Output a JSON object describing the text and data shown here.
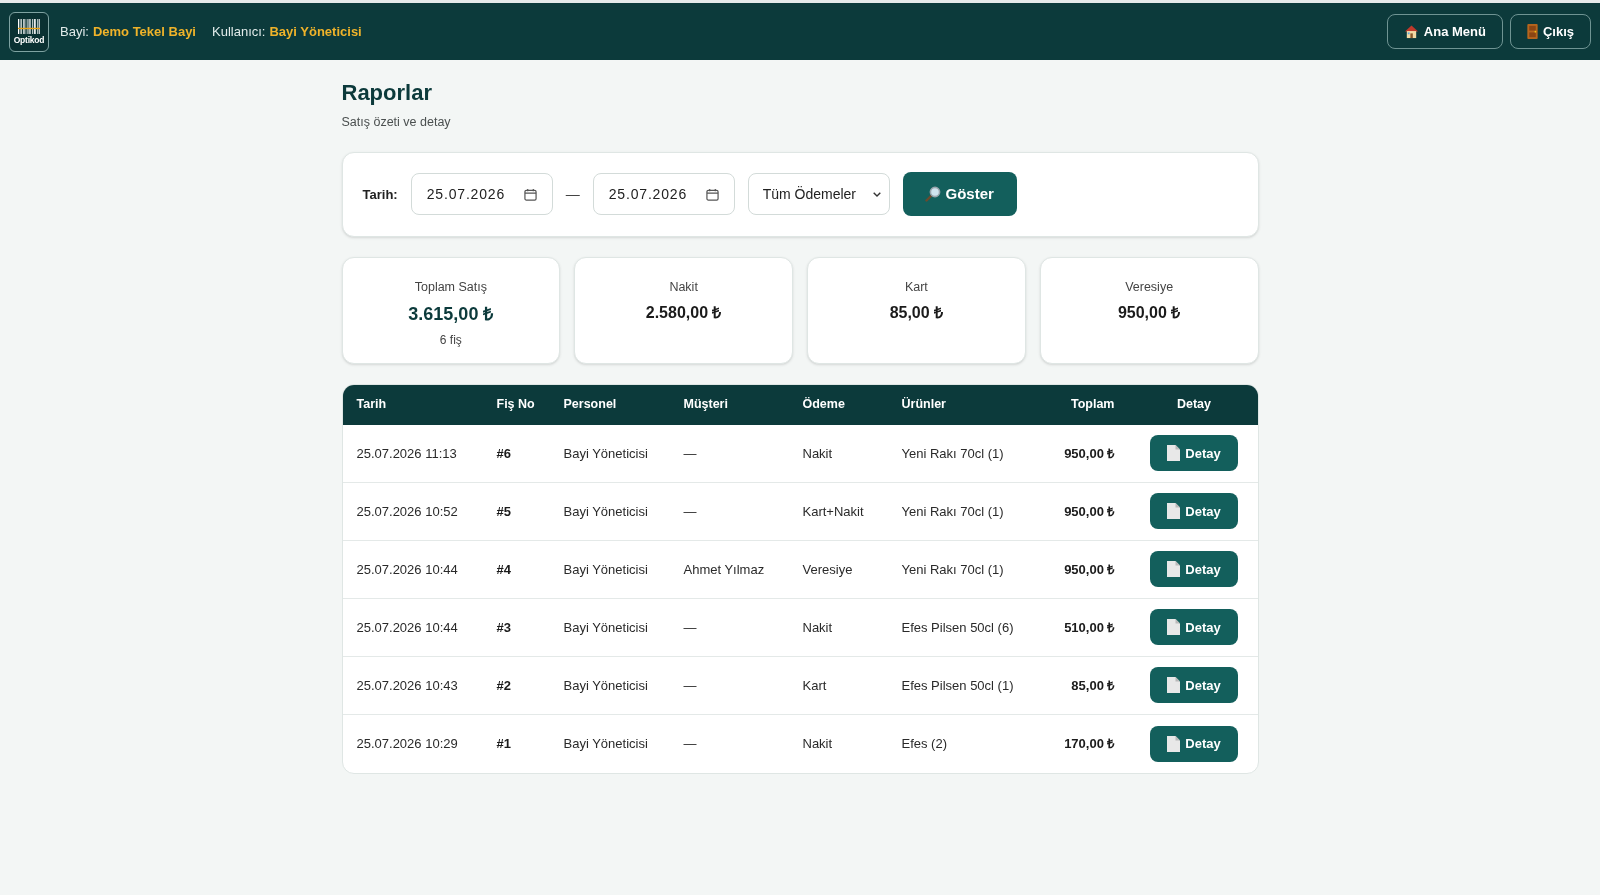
{
  "header": {
    "logo_text": "Optikod",
    "dealer_label": "Bayi:",
    "dealer": "Demo Tekel Bayi",
    "user_label": "Kullanıcı:",
    "user": "Bayi Yöneticisi",
    "buttons": [
      {
        "label": "Ana Menü",
        "kind": "home"
      },
      {
        "label": "Çıkış",
        "kind": "exit"
      }
    ]
  },
  "page": {
    "title": "Raporlar",
    "subtitle": "Satış özeti ve detay"
  },
  "filter": {
    "label": "Tarih:",
    "date_from": "25.07.2026",
    "separator": "—",
    "date_to": "25.07.2026",
    "payment_select": "Tüm Ödemeler",
    "button": "Göster"
  },
  "summary": [
    {
      "kind": "total",
      "label": "Toplam Satış",
      "value": "3.615,00 ₺",
      "note": "6 fiş"
    },
    {
      "kind": "method",
      "label": "Nakit",
      "value": "2.580,00 ₺"
    },
    {
      "kind": "method",
      "label": "Kart",
      "value": "85,00 ₺"
    },
    {
      "kind": "method",
      "label": "Veresiye",
      "value": "950,00 ₺"
    }
  ],
  "table": {
    "columns": [
      {
        "label": "Tarih",
        "kind": "text"
      },
      {
        "label": "Fiş No",
        "kind": "id"
      },
      {
        "label": "Personel",
        "kind": "text"
      },
      {
        "label": "Müşteri",
        "kind": "text"
      },
      {
        "label": "Ödeme",
        "kind": "text"
      },
      {
        "label": "Ürünler",
        "kind": "text"
      },
      {
        "label": "Toplam",
        "kind": "amount"
      },
      {
        "label": "Detay",
        "kind": "action"
      }
    ],
    "rows": [
      [
        "25.07.2026 11:13",
        "#6",
        "Bayi Yöneticisi",
        "—",
        "Nakit",
        "Yeni Rakı 70cl (1)",
        "950,00 ₺",
        "Detay"
      ],
      [
        "25.07.2026 10:52",
        "#5",
        "Bayi Yöneticisi",
        "—",
        "Kart+Nakit",
        "Yeni Rakı 70cl (1)",
        "950,00 ₺",
        "Detay"
      ],
      [
        "25.07.2026 10:44",
        "#4",
        "Bayi Yöneticisi",
        "Ahmet Yılmaz",
        "Veresiye",
        "Yeni Rakı 70cl (1)",
        "950,00 ₺",
        "Detay"
      ],
      [
        "25.07.2026 10:44",
        "#3",
        "Bayi Yöneticisi",
        "—",
        "Nakit",
        "Efes Pilsen 50cl (6)",
        "510,00 ₺",
        "Detay"
      ],
      [
        "25.07.2026 10:43",
        "#2",
        "Bayi Yöneticisi",
        "—",
        "Kart",
        "Efes Pilsen 50cl (1)",
        "85,00 ₺",
        "Detay"
      ],
      [
        "25.07.2026 10:29",
        "#1",
        "Bayi Yöneticisi",
        "—",
        "Nakit",
        "Efes (2)",
        "170,00 ₺",
        "Detay"
      ]
    ]
  }
}
